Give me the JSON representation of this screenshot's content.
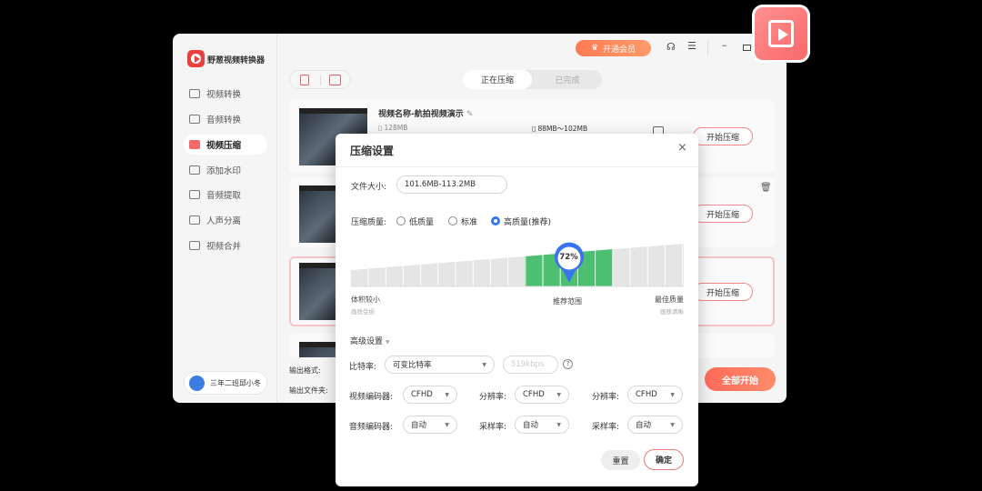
{
  "app": {
    "name": "野葱视频转换器",
    "vip_label": "开通会员"
  },
  "sidebar": {
    "items": [
      {
        "label": "视频转换"
      },
      {
        "label": "音频转换"
      },
      {
        "label": "视频压缩"
      },
      {
        "label": "添加水印"
      },
      {
        "label": "音频提取"
      },
      {
        "label": "人声分离"
      },
      {
        "label": "视频合并"
      }
    ],
    "user": "三年二班邱小冬"
  },
  "tabs": [
    "正在压缩",
    "已完成"
  ],
  "files": [
    {
      "title": "视频名称-航拍视频演示",
      "size": "128MB",
      "target": "88MB～102MB",
      "action": "开始压缩"
    },
    {
      "action": "开始压缩"
    },
    {
      "action": "开始压缩"
    }
  ],
  "bottom": {
    "format_label": "输出格式:",
    "folder_label": "输出文件夹:",
    "start_all": "全部开始"
  },
  "dialog": {
    "title": "压缩设置",
    "file_size_label": "文件大小:",
    "file_size": "101.6MB-113.2MB",
    "quality_label": "压缩质量:",
    "quality_options": [
      "低质量",
      "标准",
      "高质量(推荐)"
    ],
    "quality_selected": 2,
    "slider": {
      "percent": 72,
      "percent_label": "72%",
      "left_label": "体积较小",
      "left_sub": "画质受损",
      "mid_label": "推荐范围",
      "right_label": "最佳质量",
      "right_sub": "画质清晰"
    },
    "advanced_label": "高级设置",
    "bitrate_label": "比特率:",
    "bitrate": "可变比特率",
    "bitrate_placeholder": "519kbps",
    "video_codec_label": "视频编码器:",
    "video_codec": "CFHD",
    "resolution_label": "分辨率:",
    "resolution": "CFHD",
    "resolution2_label": "分辨率:",
    "resolution2": "CFHD",
    "audio_codec_label": "音频编码器:",
    "audio_codec": "自动",
    "sample_label": "采样率:",
    "sample": "自动",
    "sample2_label": "采样率:",
    "sample2": "自动",
    "reset": "重置",
    "ok": "确定"
  }
}
